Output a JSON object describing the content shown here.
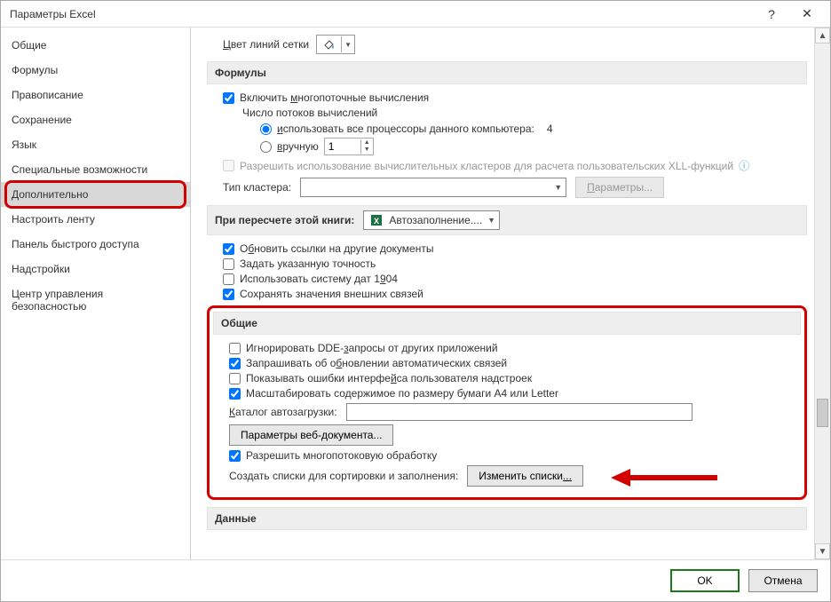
{
  "title": "Параметры Excel",
  "titlebar": {
    "help": "?",
    "close": "✕"
  },
  "sidebar": {
    "items": [
      {
        "label": "Общие"
      },
      {
        "label": "Формулы"
      },
      {
        "label": "Правописание"
      },
      {
        "label": "Сохранение"
      },
      {
        "label": "Язык"
      },
      {
        "label": "Специальные возможности"
      },
      {
        "label": "Дополнительно"
      },
      {
        "label": "Настроить ленту"
      },
      {
        "label": "Панель быстрого доступа"
      },
      {
        "label": "Надстройки"
      },
      {
        "label": "Центр управления безопасностью"
      }
    ]
  },
  "content": {
    "gridlines_label_pre": "Ц",
    "gridlines_label_mid": "вет линий сетки",
    "sec_formulas": "Формулы",
    "multithread_pre": "Включить ",
    "multithread_u": "м",
    "multithread_post": "ногопоточные вычисления",
    "threads_label": "Число потоков вычислений",
    "use_all_pre": "и",
    "use_all_post": "спользовать все процессоры данного компьютера:",
    "proc_count": "4",
    "manual_pre": "в",
    "manual_post": "ручную",
    "manual_value": "1",
    "allow_clusters_text": "Разрешить использование вычислительных кластеров для расчета пользовательских XLL-функций",
    "cluster_type_label": "Тип кластера:",
    "cluster_params_pre": "П",
    "cluster_params_post": "араметры...",
    "sec_recalc": "При пересчете этой книги:",
    "workbook_name": "Автозаполнение....",
    "upd_links_pre": "О",
    "upd_links_u": "б",
    "upd_links_post": "новить ссылки на другие документы",
    "set_precision": "Задать указанную точность",
    "date1904_pre": "Использовать систему дат 1",
    "date1904_u": "9",
    "date1904_post": "04",
    "save_ext": "Сохранять значения внешних связей",
    "sec_general": "Общие",
    "ignore_dde_pre": "Игнорировать DDE-",
    "ignore_dde_u": "з",
    "ignore_dde_post": "апросы от других приложений",
    "ask_upd_pre": "Запрашивать об о",
    "ask_upd_u": "б",
    "ask_upd_post": "новлении автоматических связей",
    "show_addin_err_pre": "Показывать ошибки интерфе",
    "show_addin_err_u": "й",
    "show_addin_err_post": "са пользователя надстроек",
    "scale_a4": "Масштабировать содержимое по размеру бумаги A4 или Letter",
    "autoload_pre": "К",
    "autoload_post": "аталог автозагрузки:",
    "autoload_value": "",
    "webdoc_pre": "Параметры веб-",
    "webdoc_u": "д",
    "webdoc_post": "окумента...",
    "multithread_proc_pre": "Разрешить многопотоковую обработку",
    "custom_lists_label": "Создать списки для сортировки и заполнения:",
    "edit_lists_pre": "Изменить списки",
    "edit_lists_suffix": "...",
    "sec_data": "Данные"
  },
  "footer": {
    "ok": "OK",
    "cancel": "Отмена"
  }
}
